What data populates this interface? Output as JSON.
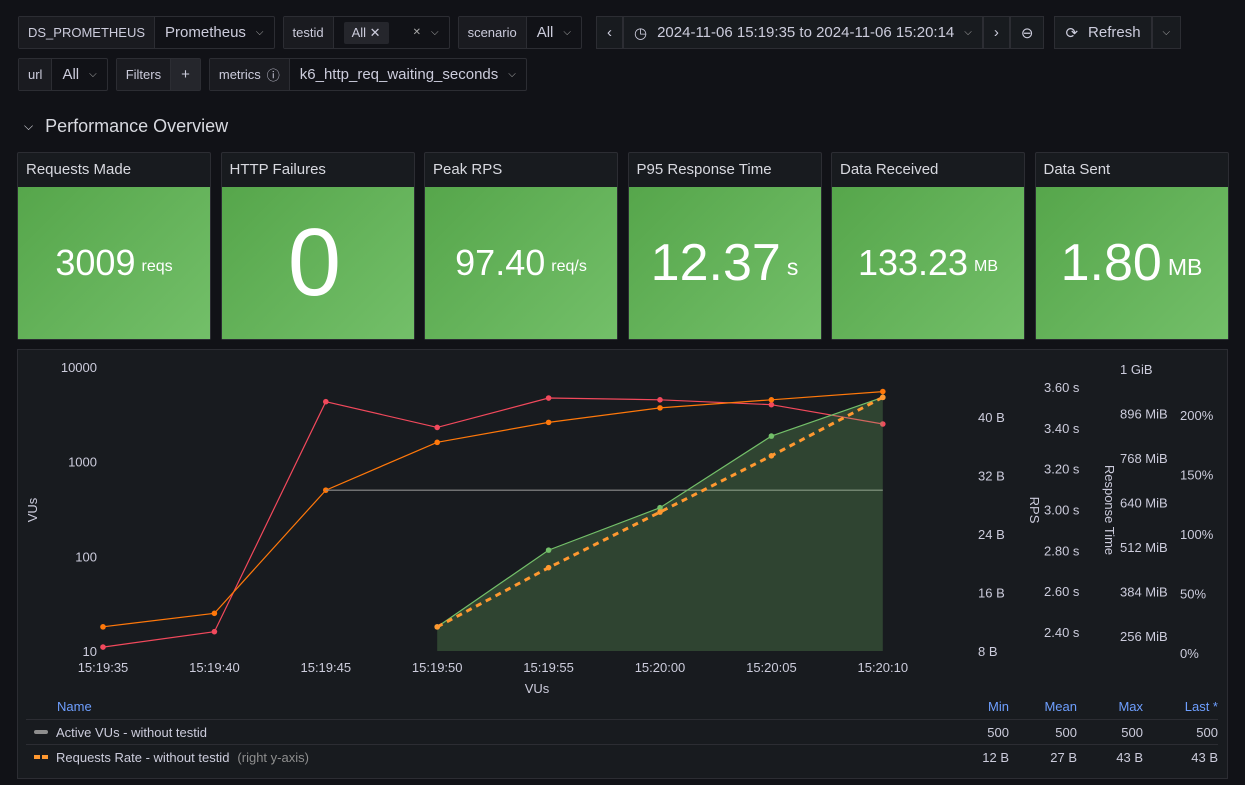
{
  "toolbar": {
    "ds_label": "DS_PROMETHEUS",
    "ds_value": "Prometheus",
    "testid_label": "testid",
    "testid_chip": "All",
    "scenario_label": "scenario",
    "scenario_value": "All",
    "time_range": "2024-11-06 15:19:35 to 2024-11-06 15:20:14",
    "refresh": "Refresh",
    "url_label": "url",
    "url_value": "All",
    "filters_label": "Filters",
    "metrics_label": "metrics",
    "metrics_value": "k6_http_req_waiting_seconds"
  },
  "section": {
    "title": "Performance Overview"
  },
  "stats": [
    {
      "title": "Requests Made",
      "value": "3009",
      "unit": "reqs",
      "color": "#56a64b"
    },
    {
      "title": "HTTP Failures",
      "value": "0",
      "unit": "",
      "color": "#56a64b"
    },
    {
      "title": "Peak RPS",
      "value": "97.40",
      "unit": "req/s",
      "color": "#56a64b"
    },
    {
      "title": "P95 Response Time",
      "value": "12.37",
      "unit": "s",
      "color": "#56a64b"
    },
    {
      "title": "Data Received",
      "value": "133.23",
      "unit": "MB",
      "color": "#56a64b"
    },
    {
      "title": "Data Sent",
      "value": "1.80",
      "unit": "MB",
      "color": "#56a64b"
    }
  ],
  "chart_data": {
    "type": "line",
    "x": [
      "15:19:35",
      "15:19:40",
      "15:19:45",
      "15:19:50",
      "15:19:55",
      "15:20:00",
      "15:20:05",
      "15:20:10"
    ],
    "xlabel": "VUs",
    "ylabel": "VUs",
    "y_scale": "log",
    "ylim": [
      10,
      10000
    ],
    "y_ticks": [
      "10",
      "100",
      "1000",
      "10000"
    ],
    "right_axes": [
      {
        "label": "",
        "ticks": [
          "8 B",
          "16 B",
          "24 B",
          "32 B",
          "40 B"
        ]
      },
      {
        "label": "RPS",
        "ticks": [
          "2.40 s",
          "2.60 s",
          "2.80 s",
          "3.00 s",
          "3.20 s",
          "3.40 s",
          "3.60 s"
        ]
      },
      {
        "label": "Response Time",
        "ticks": [
          "256 MiB",
          "384 MiB",
          "512 MiB",
          "640 MiB",
          "768 MiB",
          "896 MiB",
          "1 GiB"
        ]
      },
      {
        "label": "",
        "ticks": [
          "0%",
          "50%",
          "100%",
          "150%",
          "200%"
        ]
      }
    ],
    "series": [
      {
        "color": "#f2495c",
        "axis": "left",
        "values": [
          11,
          16,
          4300,
          2300,
          4700,
          4500,
          4000,
          2500
        ]
      },
      {
        "color": "#ff780a",
        "axis": "left",
        "values": [
          18,
          25,
          500,
          1600,
          2600,
          3700,
          4500,
          5500
        ]
      },
      {
        "name": "Active VUs - without testid",
        "color": "#8e8e8e",
        "axis": "left",
        "values": [
          null,
          null,
          500,
          500,
          500,
          500,
          500,
          500
        ]
      },
      {
        "color": "#73bf69",
        "axis": "bytes",
        "fill": true,
        "values": [
          null,
          null,
          null,
          11.3,
          21.8,
          27.6,
          37.4,
          42.7
        ]
      },
      {
        "name": "Requests Rate - without testid",
        "color": "#ff9830",
        "axis": "bytes",
        "dashed": true,
        "values": [
          null,
          null,
          null,
          11.3,
          19.4,
          27,
          34.7,
          42.7
        ]
      }
    ]
  },
  "legend": {
    "headers": [
      "Name",
      "Min",
      "Mean",
      "Max",
      "Last *"
    ],
    "rows": [
      {
        "name": "Active VUs - without testid",
        "suffix": "",
        "color": "#8e8e8e",
        "min": "500",
        "mean": "500",
        "max": "500",
        "last": "500"
      },
      {
        "name": "Requests Rate - without testid",
        "suffix": "(right y-axis)",
        "color": "#ff9830",
        "min": "12 B",
        "mean": "27 B",
        "max": "43 B",
        "last": "43 B"
      }
    ]
  }
}
